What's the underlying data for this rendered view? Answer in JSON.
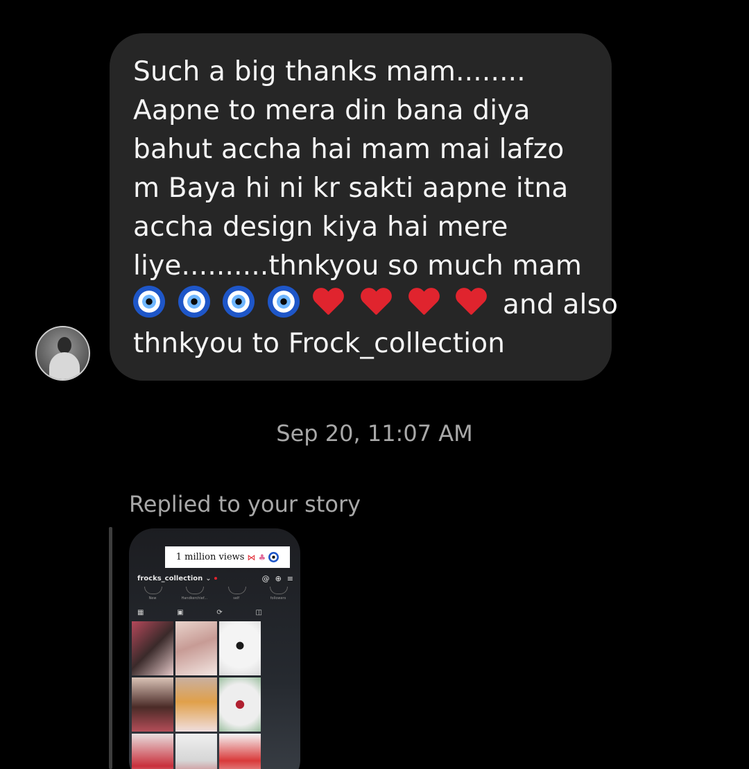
{
  "message": {
    "lines": [
      "Such a big thanks mam........",
      "Aapne to mera din bana diya",
      "bahut accha hai mam mai lafzo",
      "m Baya hi ni kr sakti aapne itna",
      "accha design kiya hai mere",
      "liye..........thnkyou so much mam",
      "and also",
      "thnkyou to Frock_collection"
    ],
    "emoji_icons": [
      "nazar-amulet-icon",
      "nazar-amulet-icon",
      "nazar-amulet-icon",
      "nazar-amulet-icon",
      "red-heart-icon",
      "red-heart-icon",
      "red-heart-icon",
      "red-heart-icon"
    ]
  },
  "timestamp": "Sep 20, 11:07 AM",
  "reply": {
    "label": "Replied to your story"
  },
  "story": {
    "sticker_text": "1 million views",
    "username": "frocks_collection",
    "highlights": [
      "New",
      "Handkerchief...",
      "self",
      "followers"
    ],
    "colors": {
      "bubble": "#262626",
      "background": "#000000",
      "secondary_text": "#a8a8a8"
    }
  }
}
